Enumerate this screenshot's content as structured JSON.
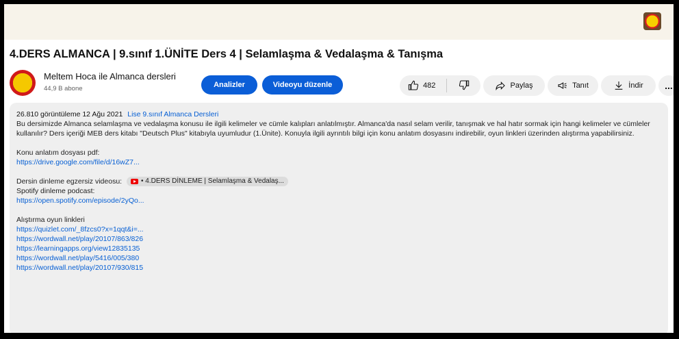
{
  "video": {
    "title": "4.DERS ALMANCA | 9.sınıf 1.ÜNİTE Ders 4 | Selamlaşma & Vedalaşma & Tanışma"
  },
  "channel": {
    "name": "Meltem Hoca ile Almanca dersleri",
    "subscribers": "44,9 B abone",
    "avatar_text": "Meltem Hoca ALMANCA"
  },
  "actions": {
    "analytics_label": "Analizler",
    "edit_label": "Videoyu düzenle",
    "like_count": "482",
    "share_label": "Paylaş",
    "promote_label": "Tanıt",
    "download_label": "İndir",
    "more_label": "..."
  },
  "description": {
    "views": "26.810 görüntüleme",
    "date": "12 Ağu 2021",
    "playlist_link": "Lise 9.sınıf Almanca Dersleri",
    "body": "Bu dersimizde Almanca selamlaşma ve vedalaşma konusu ile ilgili kelimeler ve cümle kalıpları anlatılmıştır. Almanca'da nasıl selam verilir, tanışmak ve hal hatır sormak için hangi kelimeler ve cümleler kullanılır? Ders içeriği MEB ders kitabı \"Deutsch Plus\" kitabıyla uyumludur (1.Ünite). Konuyla ilgili ayrıntılı bilgi için konu anlatım dosyasını indirebilir, oyun linkleri üzerinden alıştırma yapabilirsiniz.",
    "pdf_label": "Konu anlatım dosyası pdf:",
    "pdf_link": "https://drive.google.com/file/d/16wZ7...",
    "listening_label": "Dersin dinleme egzersiz videosu:",
    "listening_chip": "• 4.DERS DİNLEME | Selamlaşma & Vedalaş...",
    "spotify_label": "Spotify dinleme podcast:",
    "spotify_link": "https://open.spotify.com/episode/2yQo...",
    "games_label": "Alıştırma oyun linkleri",
    "game_links": [
      "https://quizlet.com/_8fzcs0?x=1qqt&i=...",
      "https://wordwall.net/play/20107/863/826",
      "https://learningapps.org/view12835135",
      "https://wordwall.net/play/5416/005/380",
      "https://wordwall.net/play/20107/930/815"
    ]
  }
}
